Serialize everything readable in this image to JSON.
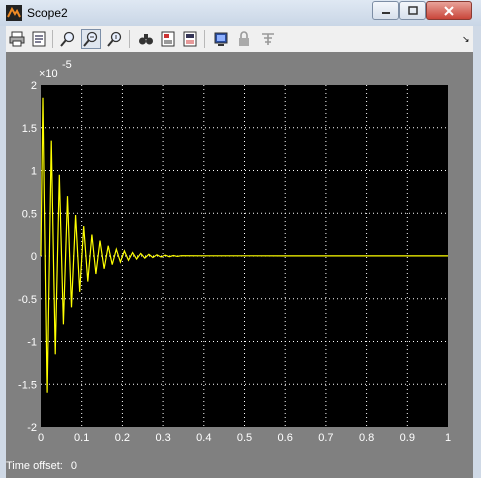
{
  "window": {
    "title": "Scope2",
    "controls": {
      "minimize": "minimize",
      "maximize": "maximize",
      "close": "close"
    }
  },
  "toolbar": {
    "items": [
      {
        "name": "print-icon"
      },
      {
        "name": "parameters-icon"
      },
      {
        "name": "zoom-icon"
      },
      {
        "name": "zoom-x-icon",
        "pressed": true
      },
      {
        "name": "zoom-y-icon"
      },
      {
        "name": "autoscale-icon"
      },
      {
        "name": "save-axes-settings-icon"
      },
      {
        "name": "restore-axes-settings-icon"
      },
      {
        "name": "floating-scope-icon"
      },
      {
        "name": "lock-axes-icon"
      },
      {
        "name": "signal-selector-icon"
      }
    ],
    "overflow": "chevron-down-icon"
  },
  "plot": {
    "exponent_label": "×10",
    "exponent_power": "-5",
    "background": "#000000",
    "line_color": "#ffff00",
    "grid": true,
    "grid_color": "#ffffff"
  },
  "footer": {
    "time_offset_label": "Time offset:",
    "time_offset_value": "0"
  },
  "chart_data": {
    "type": "line",
    "title": "",
    "xlabel": "",
    "ylabel": "",
    "xlim": [
      0,
      1
    ],
    "ylim": [
      -2,
      2
    ],
    "x_ticks": [
      "0",
      "0.1",
      "0.2",
      "0.3",
      "0.4",
      "0.5",
      "0.6",
      "0.7",
      "0.8",
      "0.9",
      "1"
    ],
    "y_ticks": [
      "2",
      "1.5",
      "1",
      "0.5",
      "0",
      "-0.5",
      "-1",
      "-1.5",
      "-2"
    ],
    "y_scale_factor": "1e-5",
    "series": [
      {
        "x": [
          0,
          0.005,
          0.015,
          0.025,
          0.035,
          0.045,
          0.055,
          0.065,
          0.075,
          0.085,
          0.095,
          0.105,
          0.115,
          0.125,
          0.135,
          0.145,
          0.155,
          0.165,
          0.175,
          0.185,
          0.195,
          0.205,
          0.215,
          0.225,
          0.235,
          0.245,
          0.255,
          0.265,
          0.275,
          0.285,
          0.295,
          0.305,
          0.315,
          0.325,
          0.335,
          0.345,
          0.4,
          0.5,
          0.6,
          0.7,
          0.8,
          0.9,
          1.0
        ],
        "values": [
          0,
          1.85,
          -1.6,
          1.35,
          -1.15,
          0.95,
          -0.8,
          0.7,
          -0.6,
          0.48,
          -0.42,
          0.35,
          -0.3,
          0.25,
          -0.21,
          0.18,
          -0.15,
          0.12,
          -0.1,
          0.08,
          -0.07,
          0.06,
          -0.05,
          0.04,
          -0.035,
          0.03,
          -0.025,
          0.02,
          -0.017,
          0.014,
          -0.012,
          0.01,
          -0.008,
          0.006,
          -0.005,
          0.004,
          0.002,
          0.002,
          0.001,
          0.001,
          0.001,
          0.001,
          0.001
        ]
      }
    ]
  }
}
